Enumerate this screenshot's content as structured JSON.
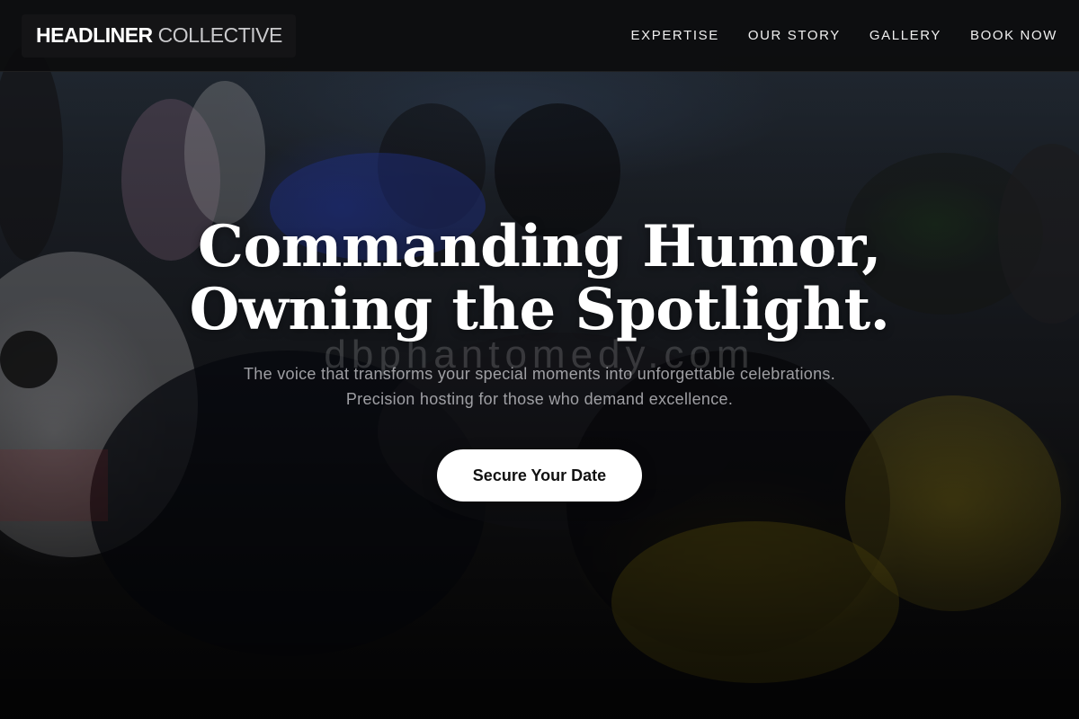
{
  "brand": {
    "name_strong": "HEADLINER",
    "name_light": "COLLECTIVE"
  },
  "nav": {
    "items": [
      {
        "label": "EXPERTISE"
      },
      {
        "label": "OUR STORY"
      },
      {
        "label": "GALLERY"
      },
      {
        "label": "BOOK NOW"
      }
    ]
  },
  "hero": {
    "headline_line1": "Commanding Humor,",
    "headline_line2": "Owning the Spotlight.",
    "watermark": "dbphantomedy.com",
    "subtext": "The voice that transforms your special moments into unforgettable celebrations. Precision hosting for those who demand excellence.",
    "cta_label": "Secure Your Date",
    "background_image": "crowd-and-motorcycles-photo"
  },
  "colors": {
    "nav_background": "#0c0c0d",
    "cta_background": "#ffffff",
    "cta_text": "#111111",
    "headline": "#ffffff"
  }
}
